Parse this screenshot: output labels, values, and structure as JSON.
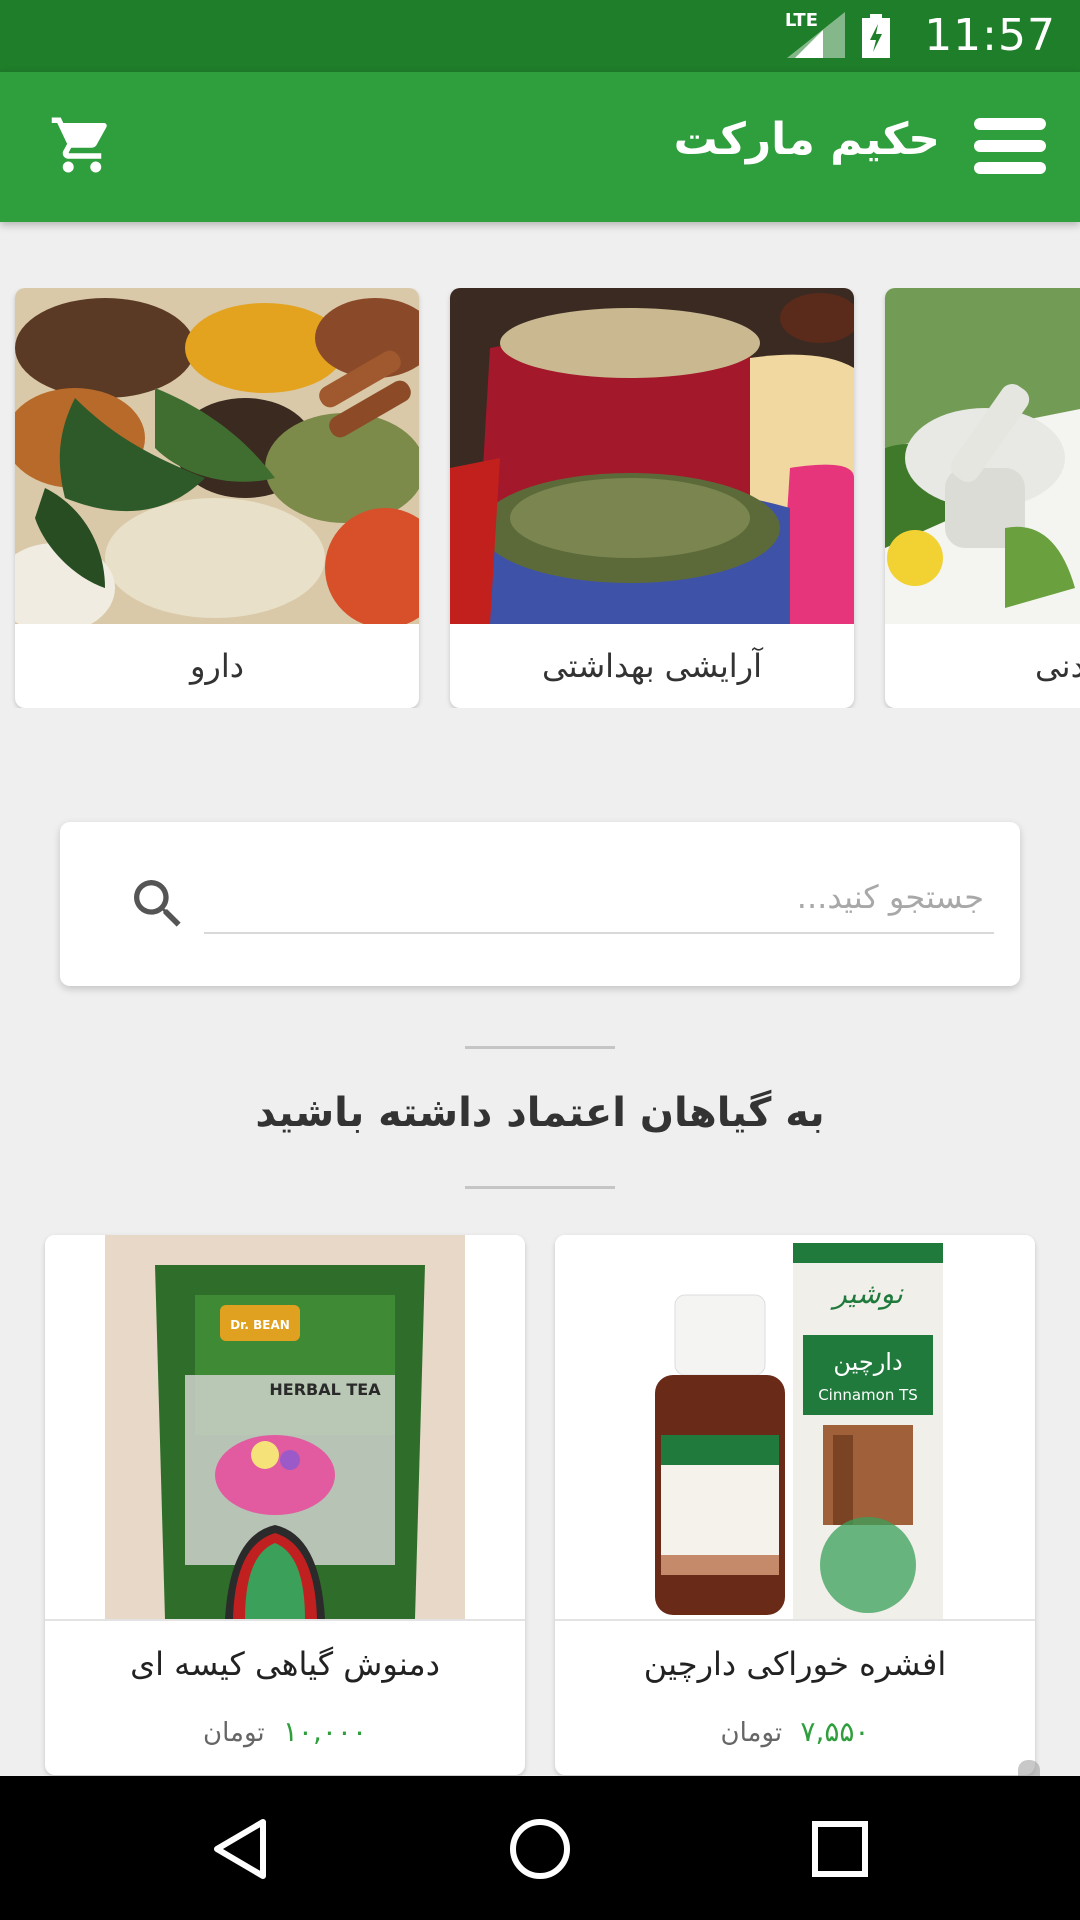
{
  "status_bar": {
    "time": "11:57",
    "network": "LTE"
  },
  "app_bar": {
    "title": "حکیم مارکت",
    "menu_icon": "hamburger-icon",
    "cart_icon": "cart-icon"
  },
  "categories": [
    {
      "label": "دارو"
    },
    {
      "label": "آرایشی بهداشتی"
    },
    {
      "label": "دنی"
    }
  ],
  "search": {
    "placeholder": "جستجو کنید...",
    "value": "",
    "icon": "search-icon"
  },
  "section": {
    "title": "به گیاهان اعتماد داشته باشید"
  },
  "products": [
    {
      "name": "افشره خوراکی دارچین",
      "price": "۷,۵۵۰",
      "currency": "تومان",
      "brand_label": "Cinnamon TS",
      "brand_fa": "دارچین"
    },
    {
      "name": "دمنوش گیاهی کیسه ای",
      "price": "۱۰,۰۰۰",
      "currency": "تومان",
      "brand_label": "HERBAL TEA",
      "brand_en": "Dr. BEAN"
    }
  ],
  "colors": {
    "status_bar": "#1f7e2a",
    "app_bar": "#2f9e3c",
    "price": "#2f9e3c",
    "background": "#efefef"
  }
}
